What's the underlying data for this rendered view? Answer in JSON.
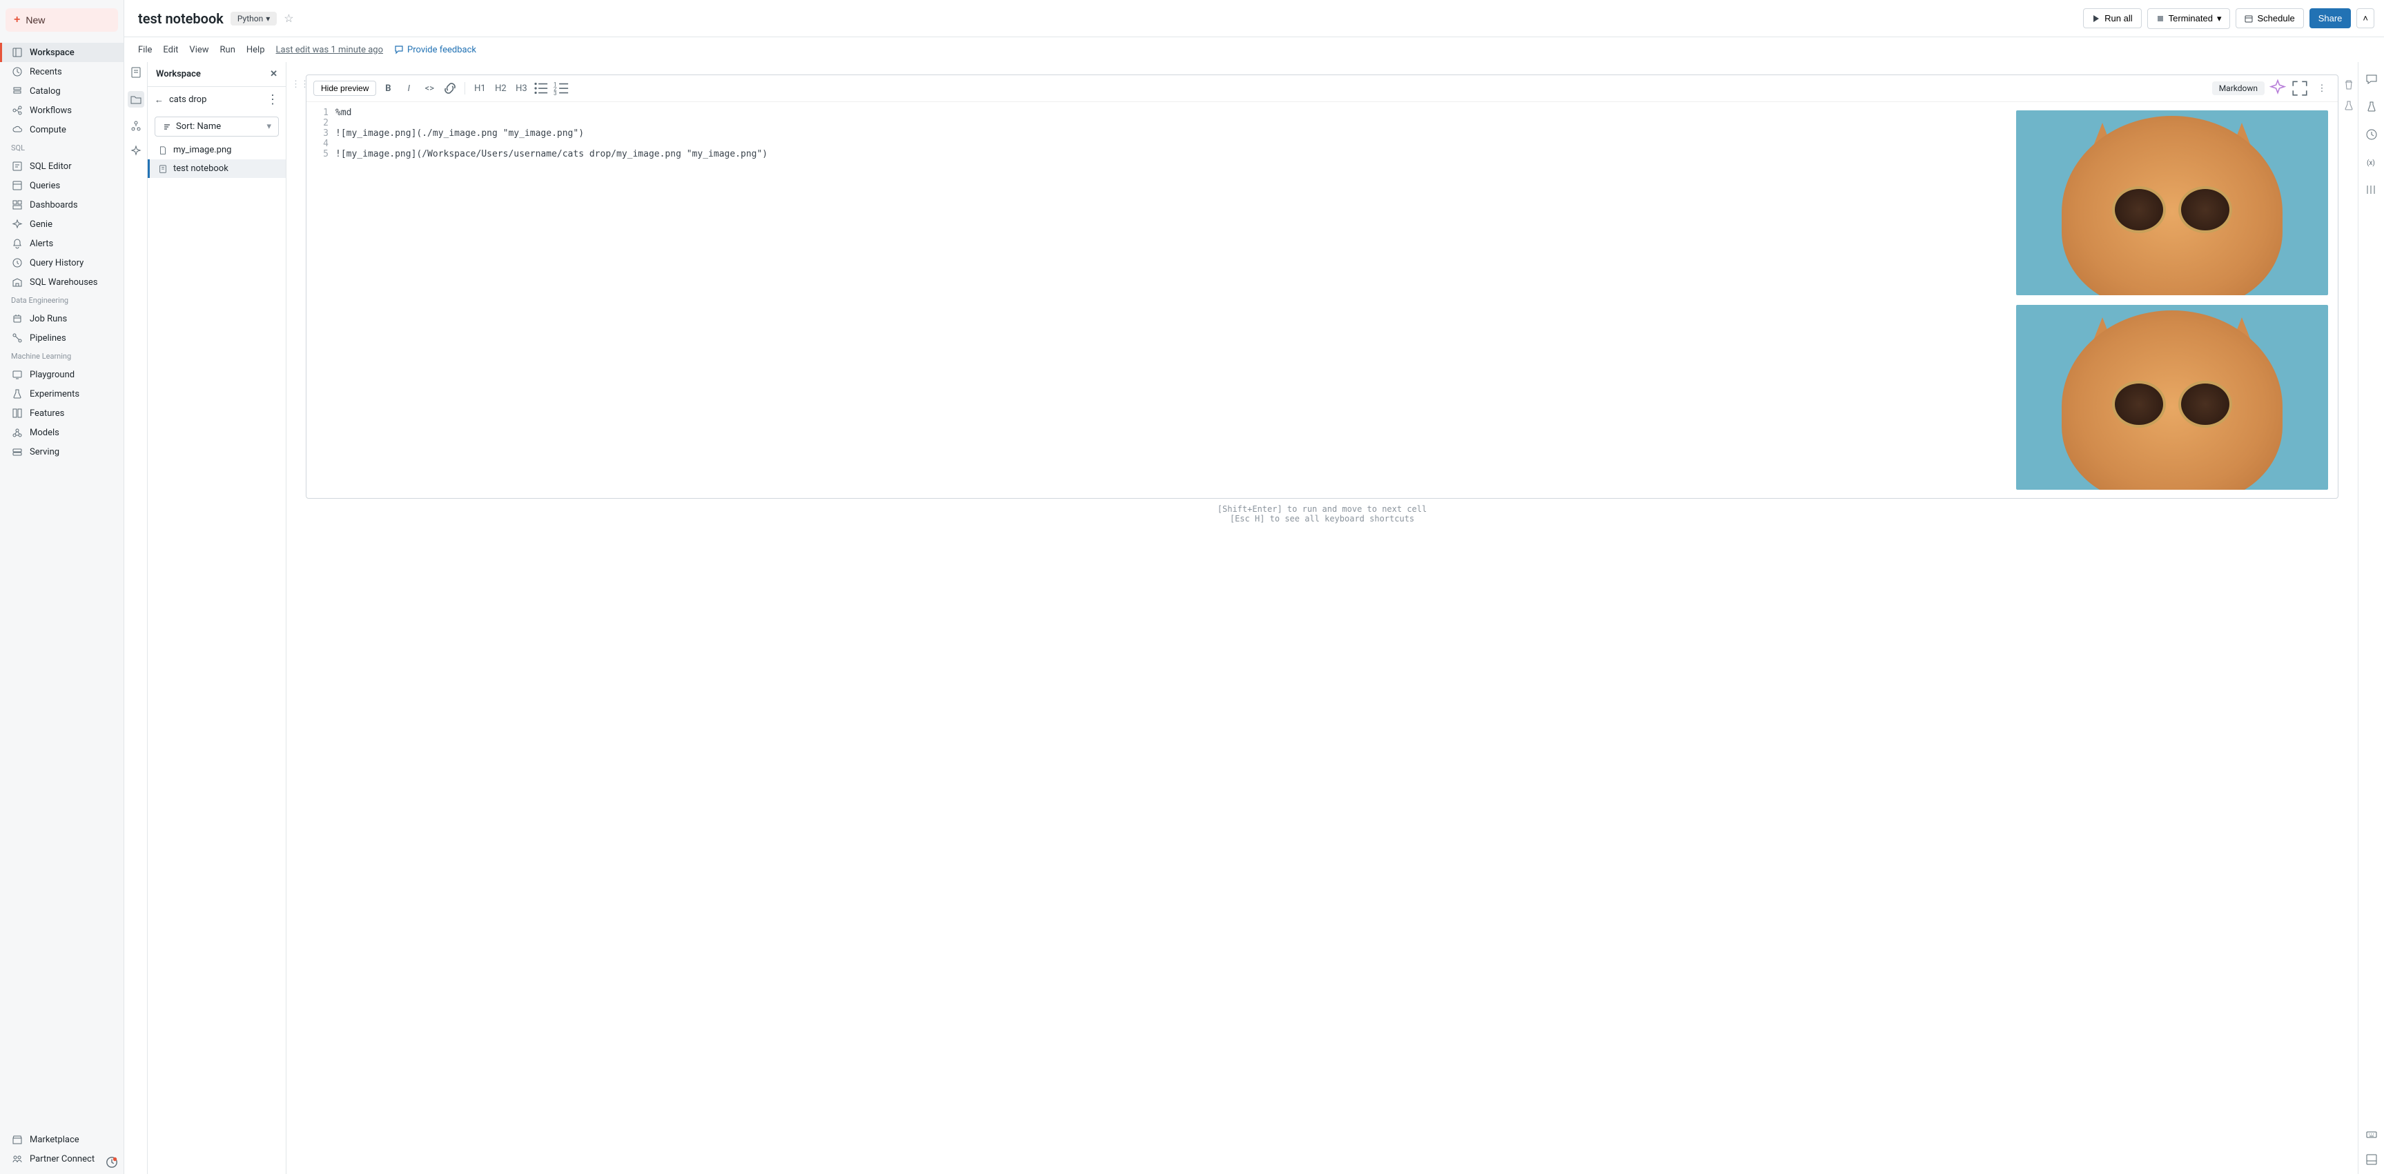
{
  "header": {
    "title": "test notebook",
    "language": "Python",
    "run_all": "Run all",
    "compute_state": "Terminated",
    "schedule": "Schedule",
    "share": "Share"
  },
  "menubar": {
    "items": [
      "File",
      "Edit",
      "View",
      "Run",
      "Help"
    ],
    "last_edit": "Last edit was 1 minute ago",
    "feedback": "Provide feedback"
  },
  "sidebar": {
    "new_label": "New",
    "main": [
      {
        "label": "Workspace",
        "icon": "workspace-icon",
        "active": true
      },
      {
        "label": "Recents",
        "icon": "clock-icon"
      },
      {
        "label": "Catalog",
        "icon": "catalog-icon"
      },
      {
        "label": "Workflows",
        "icon": "workflows-icon"
      },
      {
        "label": "Compute",
        "icon": "cloud-icon"
      }
    ],
    "sections": [
      {
        "title": "SQL",
        "items": [
          {
            "label": "SQL Editor",
            "icon": "sql-editor-icon"
          },
          {
            "label": "Queries",
            "icon": "queries-icon"
          },
          {
            "label": "Dashboards",
            "icon": "dashboards-icon"
          },
          {
            "label": "Genie",
            "icon": "genie-icon"
          },
          {
            "label": "Alerts",
            "icon": "bell-icon"
          },
          {
            "label": "Query History",
            "icon": "history-icon"
          },
          {
            "label": "SQL Warehouses",
            "icon": "warehouse-icon"
          }
        ]
      },
      {
        "title": "Data Engineering",
        "items": [
          {
            "label": "Job Runs",
            "icon": "jobs-icon"
          },
          {
            "label": "Pipelines",
            "icon": "pipelines-icon"
          }
        ]
      },
      {
        "title": "Machine Learning",
        "items": [
          {
            "label": "Playground",
            "icon": "playground-icon"
          },
          {
            "label": "Experiments",
            "icon": "experiments-icon"
          },
          {
            "label": "Features",
            "icon": "features-icon"
          },
          {
            "label": "Models",
            "icon": "models-icon"
          },
          {
            "label": "Serving",
            "icon": "serving-icon"
          }
        ]
      }
    ],
    "bottom": [
      {
        "label": "Marketplace",
        "icon": "store-icon"
      },
      {
        "label": "Partner Connect",
        "icon": "partner-icon"
      }
    ]
  },
  "explorer": {
    "title": "Workspace",
    "breadcrumb": "cats drop",
    "sort_label": "Sort: Name",
    "files": [
      {
        "label": "my_image.png",
        "icon": "file-icon"
      },
      {
        "label": "test notebook",
        "icon": "notebook-icon",
        "active": true
      }
    ]
  },
  "cell": {
    "hide_preview": "Hide preview",
    "type_label": "Markdown",
    "toolbar_heads": [
      "H1",
      "H2",
      "H3"
    ],
    "code": [
      {
        "n": "1",
        "t": "%md"
      },
      {
        "n": "2",
        "t": ""
      },
      {
        "n": "3",
        "t": "![my_image.png](./my_image.png \"my_image.png\")"
      },
      {
        "n": "4",
        "t": ""
      },
      {
        "n": "5",
        "t": "![my_image.png](/Workspace/Users/username/cats drop/my_image.png \"my_image.png\")"
      }
    ]
  },
  "hints": {
    "line1": "[Shift+Enter] to run and move to next cell",
    "line2": "[Esc H] to see all keyboard shortcuts"
  }
}
